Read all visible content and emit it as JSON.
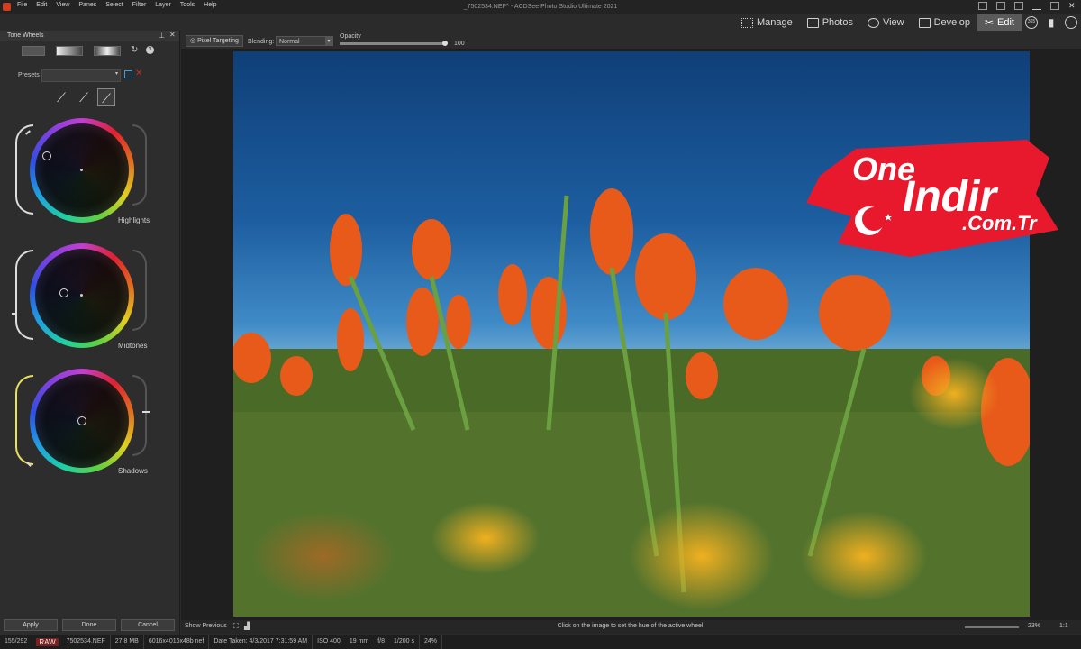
{
  "window": {
    "title": "_7502534.NEF^ - ACDSee Photo Studio Ultimate 2021"
  },
  "menu": [
    "File",
    "Edit",
    "View",
    "Panes",
    "Select",
    "Filter",
    "Layer",
    "Tools",
    "Help"
  ],
  "modes": [
    {
      "label": "Manage",
      "icon": "grid-icon"
    },
    {
      "label": "Photos",
      "icon": "photos-icon"
    },
    {
      "label": "View",
      "icon": "eye-icon"
    },
    {
      "label": "Develop",
      "icon": "develop-icon"
    },
    {
      "label": "Edit",
      "icon": "edit-icon",
      "active": true
    }
  ],
  "extra_mode_icons": [
    "365-icon",
    "dashboard-icon",
    "eye-refresh-icon"
  ],
  "panel": {
    "title": "Tone Wheels",
    "presets_label": "Presets",
    "presets_value": "",
    "wheels": [
      {
        "label": "Highlights"
      },
      {
        "label": "Midtones"
      },
      {
        "label": "Shadows"
      }
    ],
    "apply_label": "Apply",
    "done_label": "Done",
    "cancel_label": "Cancel"
  },
  "toolbar": {
    "pixel_targeting": "Pixel Targeting",
    "blending_label": "Blending:",
    "blending_value": "Normal",
    "opacity_label": "Opacity",
    "opacity_value": "100"
  },
  "watermark": {
    "line1": "One",
    "line2": "Indir",
    "line3": ".Com.Tr"
  },
  "center_status": {
    "show_previous": "Show Previous",
    "hint": "Click on the image to set the hue of the active wheel.",
    "zoom": "23%",
    "ratio": "1:1"
  },
  "statusbar": {
    "index": "155/292",
    "format": "RAW",
    "filename": "_7502534.NEF",
    "filesize": "27.8 MB",
    "dimensions": "6016x4016x48b nef",
    "date_taken": "Date Taken: 4/3/2017 7:31:59 AM",
    "iso": "ISO 400",
    "focal": "19 mm",
    "aperture": "f/8",
    "shutter": "1/200 s",
    "zoom": "24%"
  },
  "colors": {
    "accent_edit": "#5a5a5a",
    "watermark_red": "#e8192c",
    "raw_badge": "#7a2020"
  }
}
